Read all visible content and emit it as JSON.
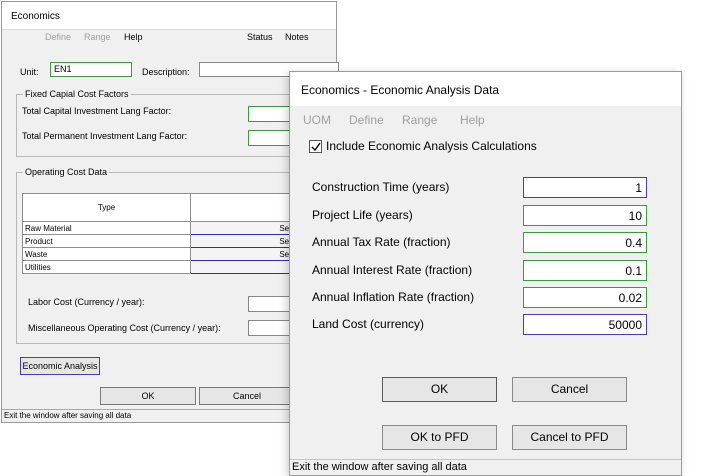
{
  "back_window": {
    "title": "Economics",
    "menu": {
      "define": "Define",
      "range": "Range",
      "help": "Help",
      "status": "Status",
      "notes": "Notes"
    },
    "unit_label": "Unit:",
    "unit_value": "EN1",
    "description_label": "Description:",
    "description_value": "",
    "fixed_group_title": "Fixed Capial Cost Factors",
    "tci_label": "Total Capital Investment Lang Factor:",
    "tci_value": "",
    "tpi_label": "Total Permanent Investment Lang Factor:",
    "tpi_value": "",
    "operating_group_title": "Operating Cost Data",
    "table": {
      "type_header": "Type",
      "rows": [
        {
          "type": "Raw Material",
          "action": "Select/View Stream"
        },
        {
          "type": "Product",
          "action": "Select/View Stream"
        },
        {
          "type": "Waste",
          "action": "Select/View Stream"
        },
        {
          "type": "Utilities",
          "action": "Select Utilities"
        }
      ]
    },
    "labor_label": "Labor Cost (Currency / year):",
    "labor_value": "",
    "misc_label": "Miscellaneous Operating Cost (Currency / year):",
    "misc_value": "",
    "economic_analysis_button": "Economic Analysis",
    "ok_button": "OK",
    "cancel_button": "Cancel",
    "status_text": "Exit the window after saving all data"
  },
  "front_window": {
    "title": "Economics - Economic Analysis Data",
    "menu": {
      "uom": "UOM",
      "define": "Define",
      "range": "Range",
      "help": "Help"
    },
    "include_label": "Include Economic Analysis Calculations",
    "include_checked": true,
    "fields": {
      "construction": {
        "label": "Construction Time (years)",
        "value": "1"
      },
      "life": {
        "label": "Project Life (years)",
        "value": "10"
      },
      "tax": {
        "label": "Annual Tax Rate (fraction)",
        "value": "0.4"
      },
      "interest": {
        "label": "Annual Interest Rate (fraction)",
        "value": "0.1"
      },
      "inflation": {
        "label": "Annual Inflation Rate (fraction)",
        "value": "0.02"
      },
      "land": {
        "label": "Land Cost (currency)",
        "value": "50000"
      }
    },
    "ok_button": "OK",
    "cancel_button": "Cancel",
    "ok_pfd_button": "OK to PFD",
    "cancel_pfd_button": "Cancel to PFD",
    "status_text": "Exit the window after saving all data"
  },
  "colors": {
    "field_green": "#3d9a3d",
    "field_blue": "#4a3bb3",
    "window_bg": "#f0f0f0",
    "disabled_text": "#9e9e9e"
  }
}
